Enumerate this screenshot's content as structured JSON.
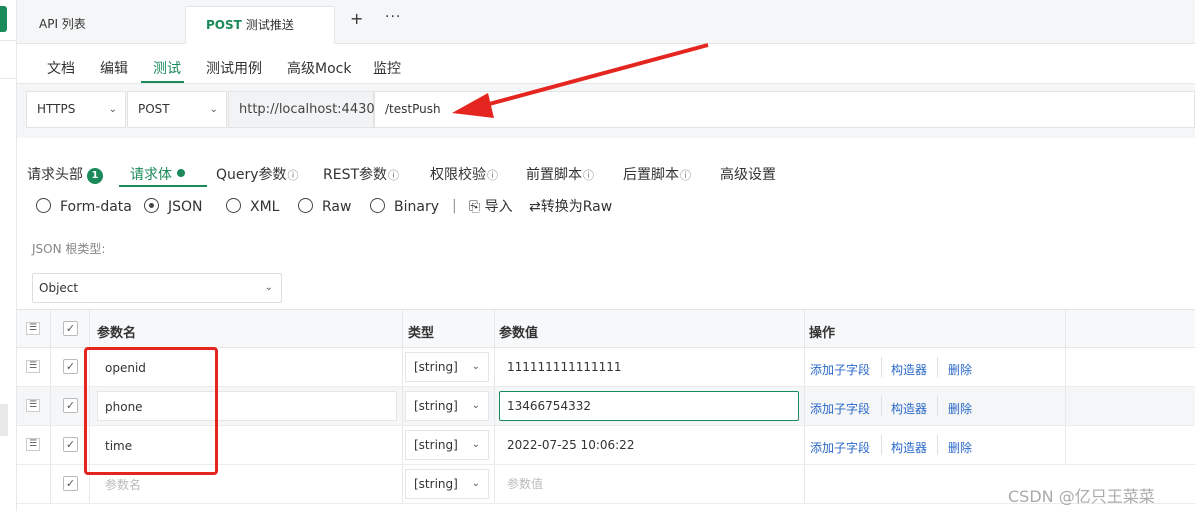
{
  "tabs": [
    {
      "label": "API 列表"
    },
    {
      "method": "POST",
      "label": "测试推送"
    }
  ],
  "tab_actions": {
    "add": "+",
    "more": "···"
  },
  "subnav": [
    "文档",
    "编辑",
    "测试",
    "测试用例",
    "高级Mock",
    "监控"
  ],
  "url": {
    "protocol": "HTTPS",
    "method": "POST",
    "host": "http://localhost:4430",
    "path": "/testPush"
  },
  "request_tabs": {
    "headers": "请求头部",
    "headers_count": "1",
    "body": "请求体",
    "query": "Query参数",
    "rest": "REST参数",
    "auth": "权限校验",
    "pre_script": "前置脚本",
    "post_script": "后置脚本",
    "advanced": "高级设置"
  },
  "body_types": [
    "Form-data",
    "JSON",
    "XML",
    "Raw",
    "Binary"
  ],
  "body_type_selected": "JSON",
  "body_actions": {
    "separator": "|",
    "import": "导入",
    "convert": "转换为Raw"
  },
  "json_root": {
    "label": "JSON 根类型:",
    "value": "Object"
  },
  "table": {
    "headers": {
      "name": "参数名",
      "type": "类型",
      "value": "参数值",
      "actions": "操作"
    },
    "rows": [
      {
        "name": "openid",
        "type": "[string]",
        "value": "111111111111111",
        "add_child": "添加子字段",
        "builder": "构造器",
        "delete": "删除"
      },
      {
        "name": "phone",
        "type": "[string]",
        "value": "13466754332",
        "add_child": "添加子字段",
        "builder": "构造器",
        "delete": "删除"
      },
      {
        "name": "time",
        "type": "[string]",
        "value": "2022-07-25 10:06:22",
        "add_child": "添加子字段",
        "builder": "构造器",
        "delete": "删除"
      }
    ],
    "new_row": {
      "name_placeholder": "参数名",
      "type": "[string]",
      "value_placeholder": "参数值"
    }
  },
  "watermark": "CSDN @亿只王菜菜",
  "colors": {
    "accent": "#1b8a5a",
    "link": "#2a68c9",
    "annotation": "#e52520"
  }
}
